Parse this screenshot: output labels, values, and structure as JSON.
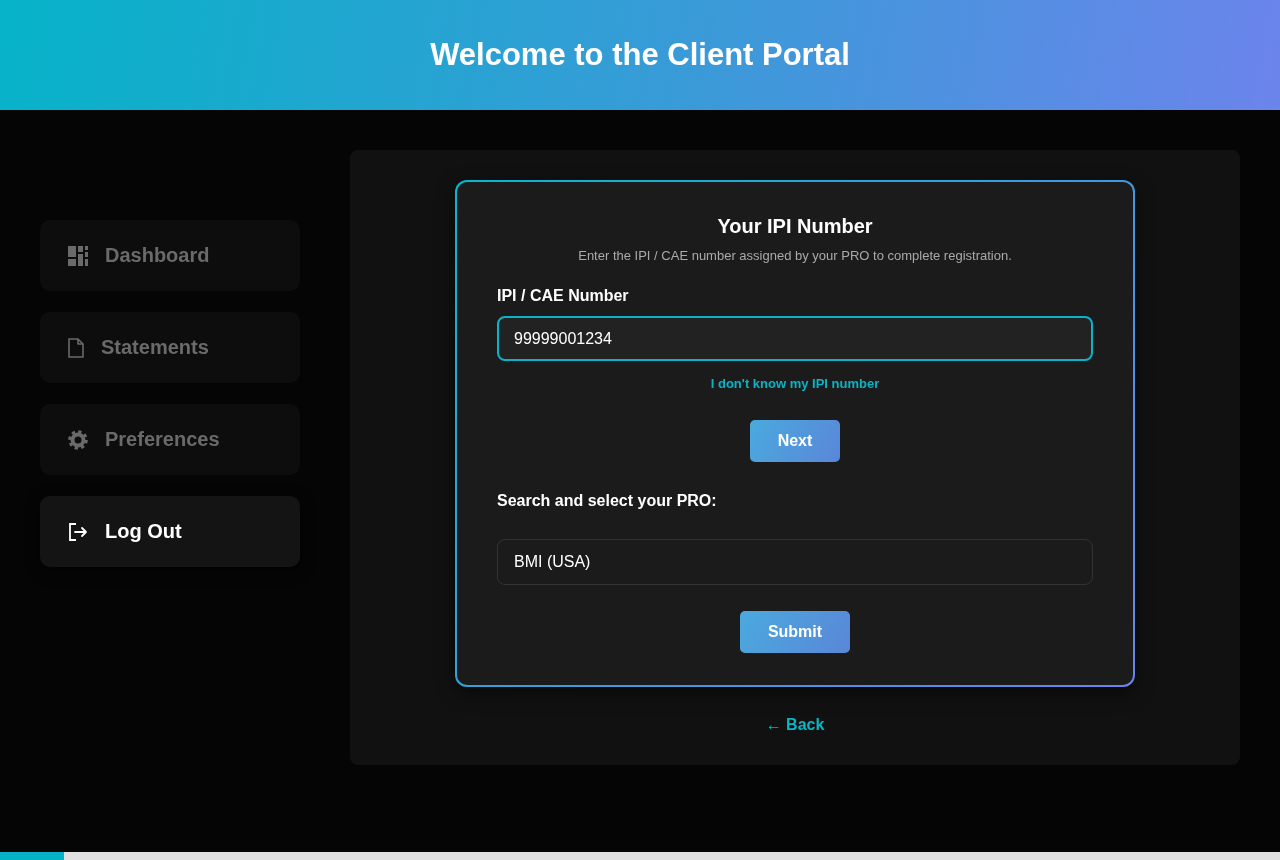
{
  "header": {
    "title": "Welcome to the Client Portal"
  },
  "sidebar": {
    "items": [
      {
        "label": "Dashboard",
        "disabled": true
      },
      {
        "label": "Statements",
        "disabled": true
      },
      {
        "label": "Preferences",
        "disabled": true
      },
      {
        "label": "Log Out",
        "disabled": false
      }
    ]
  },
  "form": {
    "title": "Your IPI Number",
    "subtitle": "Enter the IPI / CAE number assigned by your PRO to complete registration.",
    "ipi_field": {
      "label": "IPI / CAE Number",
      "value": "99999001234",
      "focused": true
    },
    "help_link": "I don't know my IPI number",
    "next_button": "Next",
    "pro_field": {
      "label": "Search and select your PRO:",
      "value": "BMI (USA)",
      "focused": false
    },
    "submit_button": "Submit"
  },
  "back_link": "← Back",
  "progress": {
    "level": 0.05
  }
}
